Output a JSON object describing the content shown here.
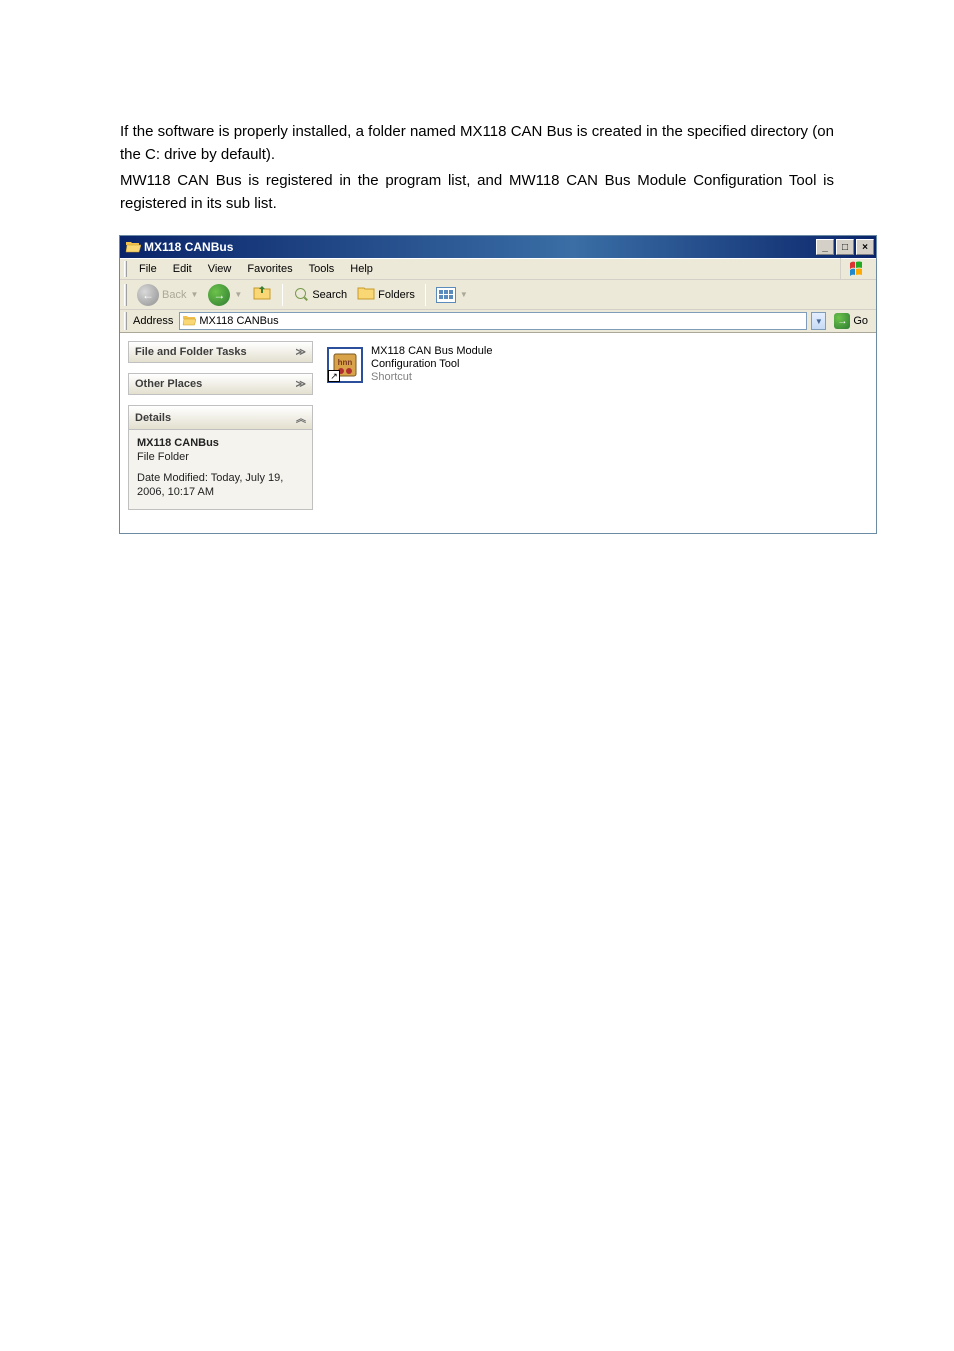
{
  "doc": {
    "p1": "If the software is properly installed, a folder named MX118 CAN Bus is created in the specified directory (on the C: drive by default).",
    "p2": "MW118 CAN Bus is registered in the program list, and MW118 CAN Bus Module Configuration Tool is registered in its sub list."
  },
  "window": {
    "title": "MX118 CANBus",
    "min": "_",
    "max": "□",
    "close": "×"
  },
  "menu": {
    "file": "File",
    "edit": "Edit",
    "view": "View",
    "favorites": "Favorites",
    "tools": "Tools",
    "help": "Help"
  },
  "toolbar": {
    "back": "Back",
    "search": "Search",
    "folders": "Folders"
  },
  "address": {
    "label": "Address",
    "value": "MX118 CANBus",
    "go": "Go"
  },
  "tasks": {
    "file_folder": "File and Folder Tasks",
    "other_places": "Other Places",
    "details": "Details",
    "details_body_title": "MX118 CANBus",
    "details_body_type": "File Folder",
    "details_body_modified": "Date Modified: Today, July 19, 2006, 10:17 AM"
  },
  "item": {
    "line1": "MX118 CAN Bus Module",
    "line2": "Configuration Tool",
    "line3": "Shortcut"
  }
}
